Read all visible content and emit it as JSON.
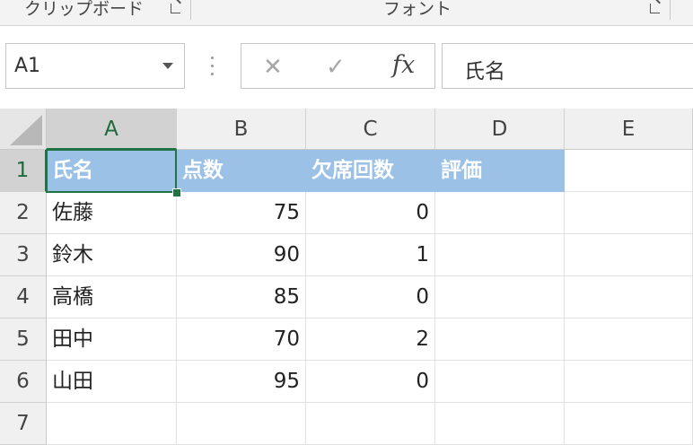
{
  "ribbon": {
    "clipboard_label": "クリップボード",
    "font_label": "フォント"
  },
  "formula_bar": {
    "name_box": "A1",
    "cancel_icon": "close-icon",
    "enter_icon": "check-icon",
    "fx_label": "fx",
    "content": "氏名"
  },
  "columns": [
    "A",
    "B",
    "C",
    "D",
    "E"
  ],
  "rows": [
    "1",
    "2",
    "3",
    "4",
    "5",
    "6",
    "7"
  ],
  "cells": [
    [
      "氏名",
      "点数",
      "欠席回数",
      "評価",
      ""
    ],
    [
      "佐藤",
      "75",
      "0",
      "",
      ""
    ],
    [
      "鈴木",
      "90",
      "1",
      "",
      ""
    ],
    [
      "高橋",
      "85",
      "0",
      "",
      ""
    ],
    [
      "田中",
      "70",
      "2",
      "",
      ""
    ],
    [
      "山田",
      "95",
      "0",
      "",
      ""
    ],
    [
      "",
      "",
      "",
      "",
      ""
    ]
  ],
  "colors": {
    "header_fill": "#9bc2e6",
    "selection": "#217346"
  }
}
